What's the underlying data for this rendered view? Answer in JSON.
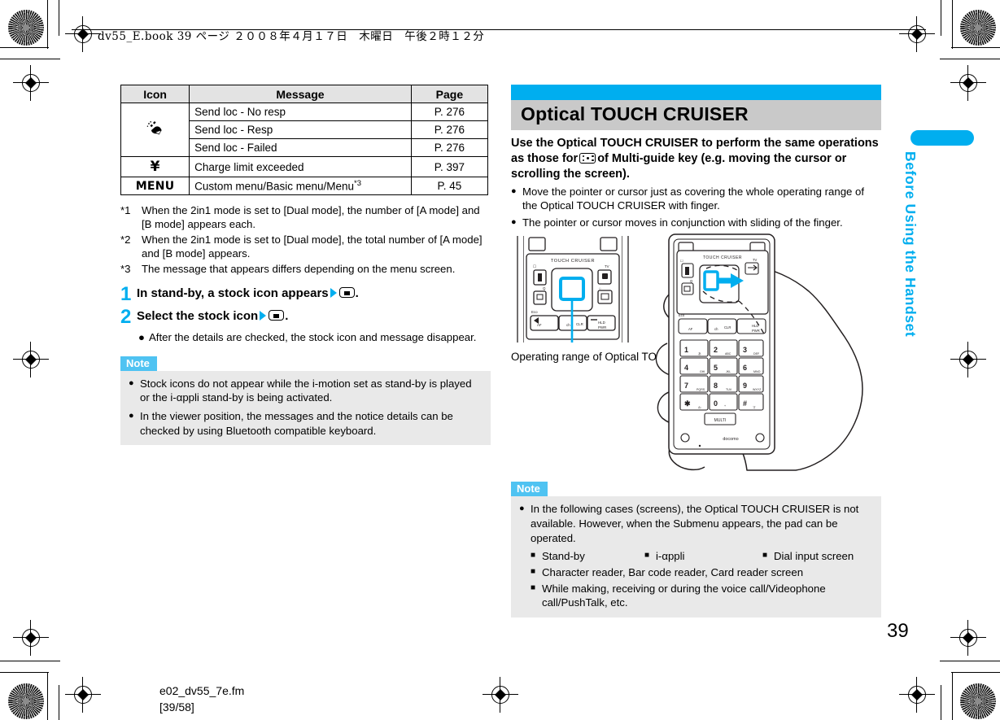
{
  "book_header": "dv55_E.book  39 ページ  ２００８年４月１７日　木曜日　午後２時１２分",
  "side_tab_label": "Before Using the Handset",
  "page_number": "39",
  "footer": {
    "file": "e02_dv55_7e.fm",
    "range": "[39/58]"
  },
  "colors": {
    "accent_cyan": "#00AEEF",
    "note_tab": "#4FC3F2",
    "note_bg": "#e9e9e9",
    "title_bg": "#c9c9c9",
    "table_head_bg": "#e3e3e3"
  },
  "icon_table": {
    "headers": [
      "Icon",
      "Message",
      "Page"
    ],
    "rows": [
      {
        "icon": "satellite-location-icon",
        "icon_glyph": "🛰",
        "message": "Send loc - No resp",
        "page": "P. 276"
      },
      {
        "icon": "satellite-location-icon",
        "icon_glyph": "",
        "message": "Send loc - Resp",
        "page": "P. 276"
      },
      {
        "icon": "satellite-location-icon",
        "icon_glyph": "",
        "message": "Send loc - Failed",
        "page": "P. 276"
      },
      {
        "icon": "yen-icon",
        "icon_glyph": "¥",
        "message": "Charge limit exceeded",
        "page": "P. 397"
      },
      {
        "icon": "menu-icon",
        "icon_glyph": "MENU",
        "message": "Custom menu/Basic menu/Menu",
        "message_sup": "*3",
        "page": "P. 45"
      }
    ]
  },
  "footnotes": [
    {
      "mark": "*1",
      "text": "When the 2in1 mode is set to [Dual mode], the number of [A mode] and [B mode] appears each."
    },
    {
      "mark": "*2",
      "text": "When the 2in1 mode is set to [Dual mode], the total number of [A mode] and [B mode] appears."
    },
    {
      "mark": "*3",
      "text": "The message that appears differs depending on the menu screen."
    }
  ],
  "steps": [
    {
      "num": "1",
      "text_before": "In stand-by, a stock icon appears",
      "text_after": "."
    },
    {
      "num": "2",
      "text_before": "Select the stock icon",
      "text_after": "."
    }
  ],
  "step2_sub_bullet": "After the details are checked, the stock icon and message disappear.",
  "note_left": {
    "label": "Note",
    "items": [
      "Stock icons do not appear while the i-motion set as stand-by is played or the i-αppli stand-by is being activated.",
      "In the viewer position, the messages and the notice details can be checked by using Bluetooth compatible keyboard."
    ]
  },
  "section": {
    "title": "Optical TOUCH CRUISER",
    "lead_part1": "Use the Optical TOUCH CRUISER to perform the same operations as those for",
    "lead_part2": "of Multi-guide key (e.g. moving the cursor or scrolling the screen).",
    "bullets": [
      "Move the pointer or cursor just as covering the whole operating range of the Optical TOUCH CRUISER with finger.",
      "The pointer or cursor moves in conjunction with sliding of the finger."
    ]
  },
  "figure": {
    "caption": "Operating range of Optical TOUCH CRUISER",
    "phone_logo": "TOUCH CRUISER",
    "key_labels": [
      "AF",
      "ch",
      "CLR",
      "HLD",
      "PWR",
      "TV",
      "MULTI"
    ],
    "keypad_digits": [
      "1",
      "2",
      "3",
      "4",
      "5",
      "6",
      "7",
      "8",
      "9",
      "*",
      "0",
      "#"
    ],
    "keypad_sublabels": [
      "",
      "ABC",
      "DEF",
      "GHI",
      "JKL",
      "MNO",
      "PQRS",
      "TUV",
      "WXYZ",
      "",
      "+",
      ""
    ],
    "brand": "docomo"
  },
  "note_right": {
    "label": "Note",
    "lead": "In the following cases (screens), the Optical TOUCH CRUISER is not available. However, when the Submenu appears, the pad can be operated.",
    "row_items": [
      "Stand-by",
      "i-αppli",
      "Dial input screen"
    ],
    "items": [
      "Character reader, Bar code reader, Card reader screen",
      "While making, receiving or during the voice call/Videophone call/PushTalk, etc."
    ]
  }
}
